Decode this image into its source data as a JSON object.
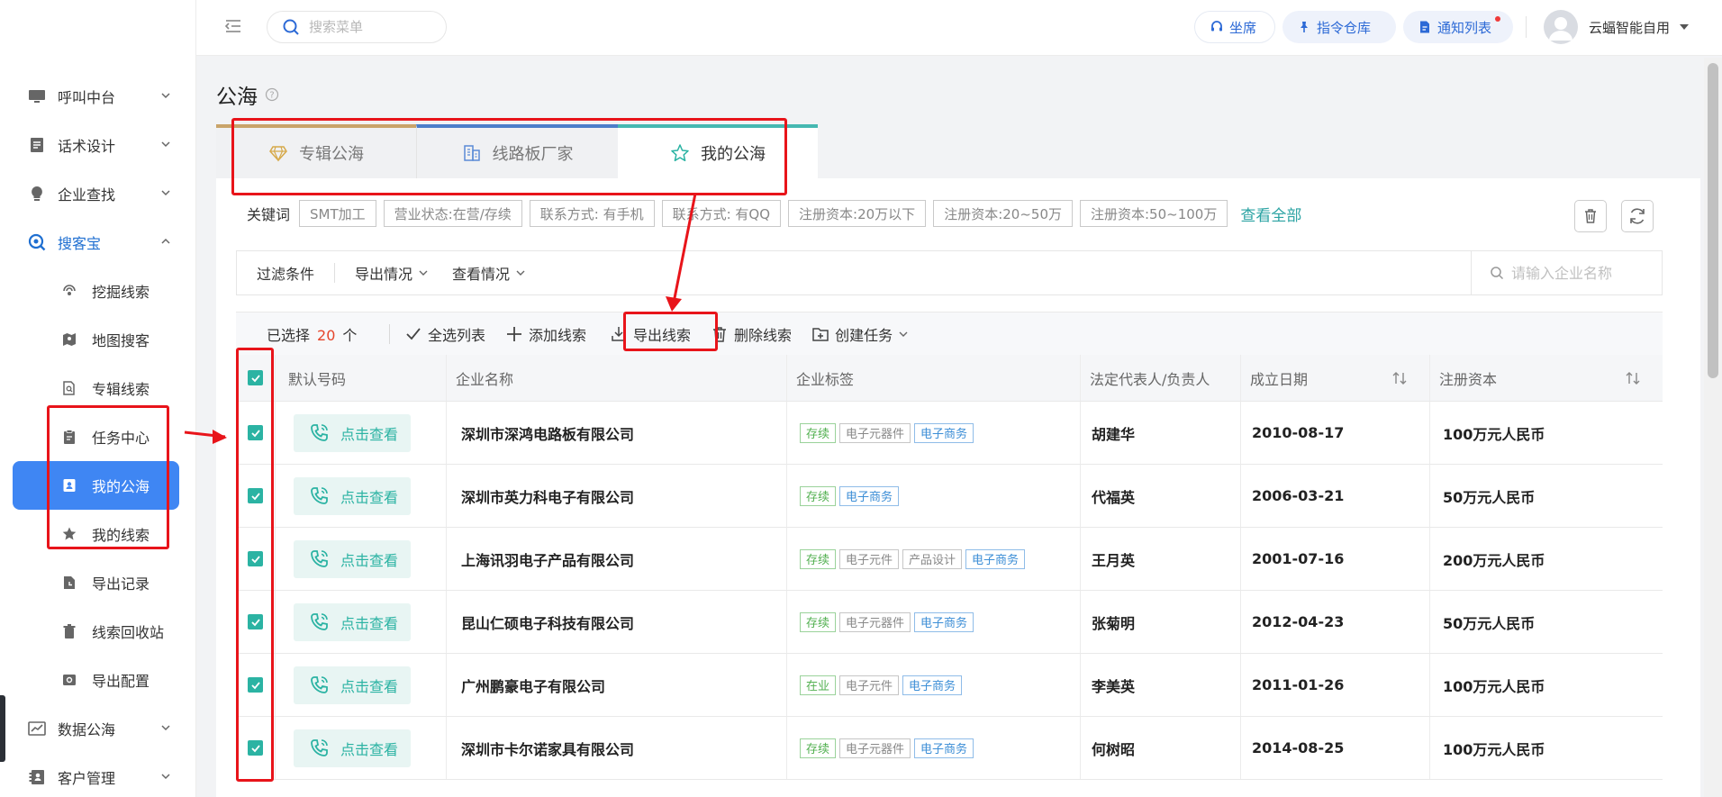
{
  "header": {
    "search_placeholder": "搜索菜单",
    "seat": "坐席",
    "command_repo": "指令仓库",
    "notify_list": "通知列表",
    "user_name": "云蝠智能自用"
  },
  "sidebar": {
    "items": [
      {
        "label": "呼叫中台",
        "level": "parent"
      },
      {
        "label": "话术设计",
        "level": "parent"
      },
      {
        "label": "企业查找",
        "level": "parent"
      },
      {
        "label": "搜客宝",
        "level": "parent",
        "expanded": true
      },
      {
        "label": "挖掘线索",
        "level": "child"
      },
      {
        "label": "地图搜客",
        "level": "child"
      },
      {
        "label": "专辑线索",
        "level": "child"
      },
      {
        "label": "任务中心",
        "level": "child"
      },
      {
        "label": "我的公海",
        "level": "child",
        "active": true
      },
      {
        "label": "我的线索",
        "level": "child"
      },
      {
        "label": "导出记录",
        "level": "child"
      },
      {
        "label": "线索回收站",
        "level": "child"
      },
      {
        "label": "导出配置",
        "level": "child"
      },
      {
        "label": "数据公海",
        "level": "parent"
      },
      {
        "label": "客户管理",
        "level": "parent"
      }
    ]
  },
  "page": {
    "title": "公海",
    "tabs": [
      "专辑公海",
      "线路板厂家",
      "我的公海"
    ]
  },
  "keywords": {
    "label": "关键词",
    "chips": [
      "SMT加工",
      "营业状态:在营/存续",
      "联系方式: 有手机",
      "联系方式: 有QQ",
      "注册资本:20万以下",
      "注册资本:20~50万",
      "注册资本:50~100万"
    ],
    "view_all": "查看全部"
  },
  "filters": {
    "condition": "过滤条件",
    "export_status": "导出情况",
    "view_status": "查看情况",
    "search_placeholder": "请输入企业名称"
  },
  "actions": {
    "selected_prefix": "已选择",
    "selected_count": "20",
    "selected_suffix": "个",
    "select_all": "全选列表",
    "add_lead": "添加线索",
    "export_lead": "导出线索",
    "delete_lead": "删除线索",
    "create_task": "创建任务"
  },
  "table": {
    "columns": [
      "默认号码",
      "企业名称",
      "企业标签",
      "法定代表人/负责人",
      "成立日期",
      "注册资本"
    ],
    "view_label": "点击查看",
    "rows": [
      {
        "name": "深圳市深鸿电路板有限公司",
        "tags": [
          [
            "存续",
            "green"
          ],
          [
            "电子元器件",
            "gray"
          ],
          [
            "电子商务",
            "blue"
          ]
        ],
        "legal": "胡建华",
        "date": "2010-08-17",
        "capital": "100万元人民币"
      },
      {
        "name": "深圳市英力科电子有限公司",
        "tags": [
          [
            "存续",
            "green"
          ],
          [
            "电子商务",
            "blue"
          ]
        ],
        "legal": "代福英",
        "date": "2006-03-21",
        "capital": "50万元人民币"
      },
      {
        "name": "上海讯羽电子产品有限公司",
        "tags": [
          [
            "存续",
            "green"
          ],
          [
            "电子元件",
            "gray"
          ],
          [
            "产品设计",
            "gray"
          ],
          [
            "电子商务",
            "blue"
          ]
        ],
        "legal": "王月英",
        "date": "2001-07-16",
        "capital": "200万元人民币"
      },
      {
        "name": "昆山仁硕电子科技有限公司",
        "tags": [
          [
            "存续",
            "green"
          ],
          [
            "电子元器件",
            "gray"
          ],
          [
            "电子商务",
            "blue"
          ]
        ],
        "legal": "张菊明",
        "date": "2012-04-23",
        "capital": "50万元人民币"
      },
      {
        "name": "广州鹏豪电子有限公司",
        "tags": [
          [
            "在业",
            "green"
          ],
          [
            "电子元件",
            "gray"
          ],
          [
            "电子商务",
            "blue"
          ]
        ],
        "legal": "李美英",
        "date": "2011-01-26",
        "capital": "100万元人民币"
      },
      {
        "name": "深圳市卡尔诺家具有限公司",
        "tags": [
          [
            "存续",
            "green"
          ],
          [
            "电子元器件",
            "gray"
          ],
          [
            "电子商务",
            "blue"
          ]
        ],
        "legal": "何树昭",
        "date": "2014-08-25",
        "capital": "100万元人民币"
      }
    ]
  },
  "colors": {
    "accent_teal": "#2bb3a3",
    "sidebar_active": "#3f86f3",
    "annotation_red": "#e8141a"
  }
}
